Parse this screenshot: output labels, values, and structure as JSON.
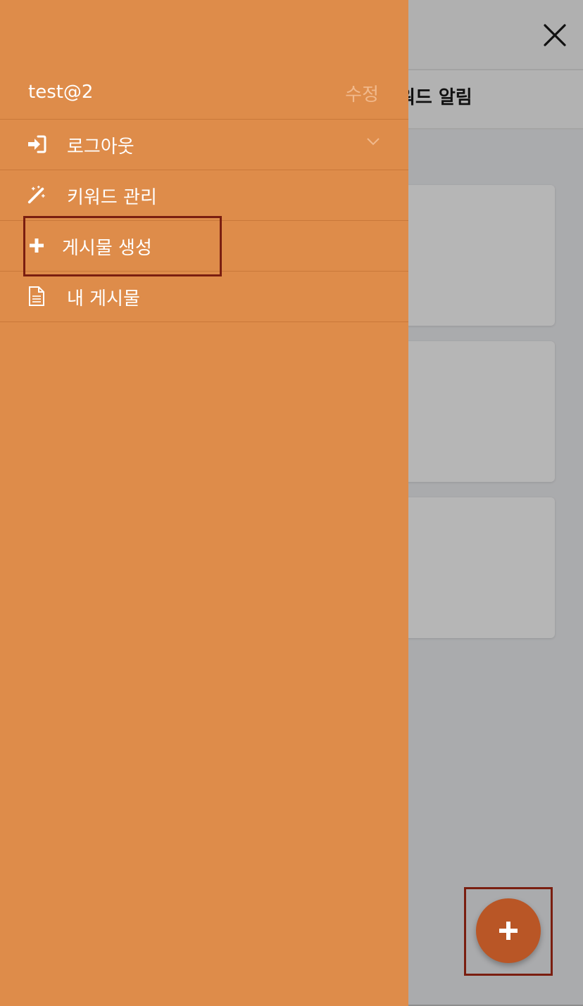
{
  "background": {
    "tab_title": "워드 알림"
  },
  "drawer": {
    "user": {
      "name": "test@2",
      "edit_label": "수정"
    },
    "menu": [
      {
        "label": "로그아웃",
        "icon": "sign-in-icon"
      },
      {
        "label": "키워드 관리",
        "icon": "magic-wand-icon"
      },
      {
        "label": "게시물 생성",
        "icon": "plus-icon"
      },
      {
        "label": "내 게시물",
        "icon": "document-icon"
      }
    ]
  },
  "fab": {
    "icon": "plus-icon"
  },
  "colors": {
    "drawer_background": "#de8c4a",
    "drawer_divider": "#c9783a",
    "fab_background": "#b95626",
    "highlight_border": "#7a1e10",
    "overlay": "#aaabad"
  }
}
